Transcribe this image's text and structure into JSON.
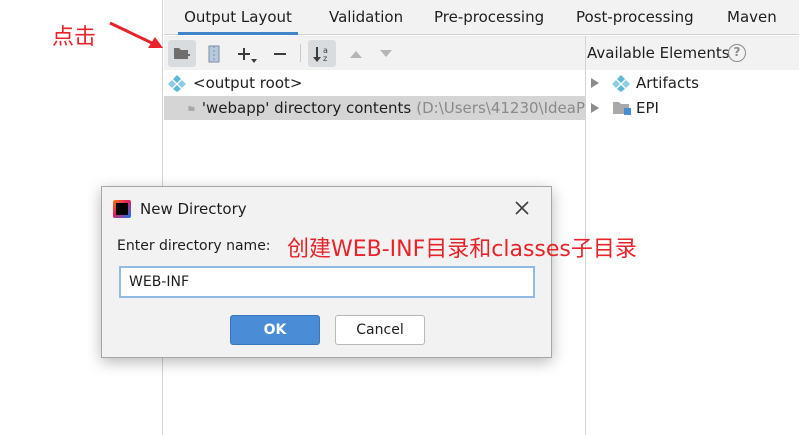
{
  "annotations": {
    "click_hint": "点击",
    "create_hint": "创建WEB-INF目录和classes子目录",
    "color": "#e8232a"
  },
  "tabs": [
    {
      "label": "Output Layout",
      "active": true
    },
    {
      "label": "Validation"
    },
    {
      "label": "Pre-processing"
    },
    {
      "label": "Post-processing"
    },
    {
      "label": "Maven"
    }
  ],
  "toolbar": {
    "icons": [
      "new-folder-icon",
      "archive-icon",
      "add-icon",
      "remove-icon",
      "sort-icon",
      "move-up-icon",
      "move-down-icon"
    ]
  },
  "layout_tree": {
    "root": "<output root>",
    "child": {
      "name": "'webapp' directory contents",
      "path": "(D:\\Users\\41230\\IdeaP"
    }
  },
  "available": {
    "title": "Available Elements",
    "help": "?",
    "items": [
      {
        "label": "Artifacts",
        "icon": "artifacts-icon"
      },
      {
        "label": "EPI",
        "icon": "module-folder-icon"
      }
    ]
  },
  "dialog": {
    "title": "New Directory",
    "prompt": "Enter directory name:",
    "value": "WEB-INF",
    "ok": "OK",
    "cancel": "Cancel"
  },
  "colors": {
    "accent": "#4083c9",
    "ok_button": "#4a8cd6",
    "toolbar_bg": "#f2f2f2",
    "selection": "#d5d5d5"
  }
}
